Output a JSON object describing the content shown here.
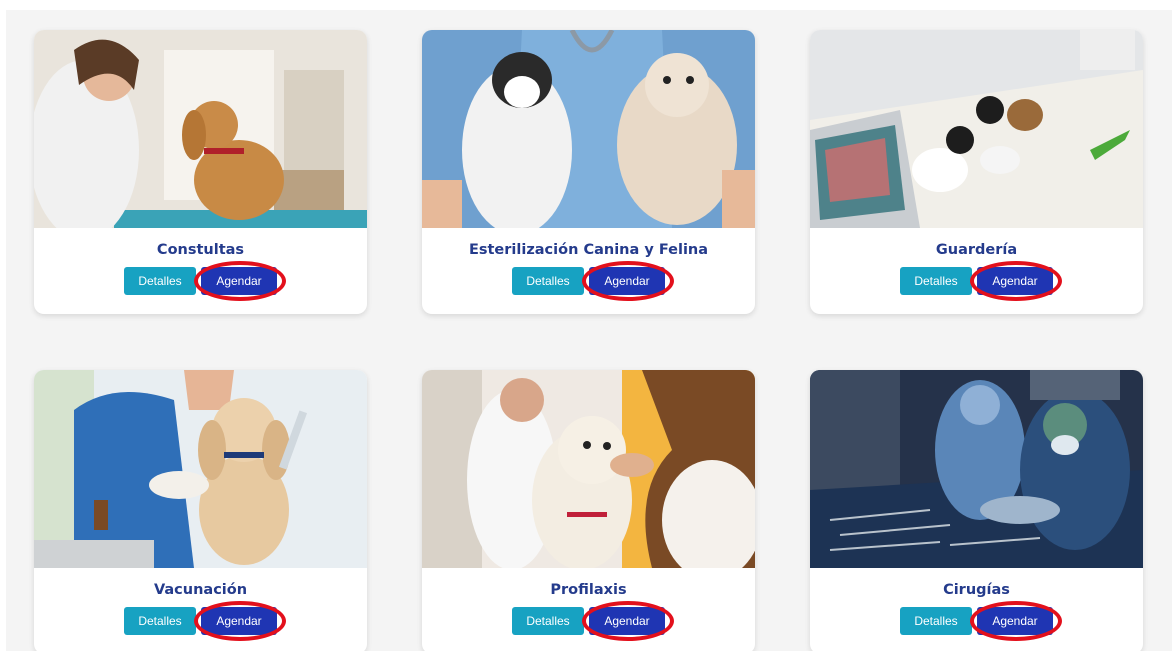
{
  "services": [
    {
      "title": "Constultas",
      "details_label": "Detalles",
      "schedule_label": "Agendar"
    },
    {
      "title": "Esterilización Canina y Felina",
      "details_label": "Detalles",
      "schedule_label": "Agendar"
    },
    {
      "title": "Guardería",
      "details_label": "Detalles",
      "schedule_label": "Agendar"
    },
    {
      "title": "Vacunación",
      "details_label": "Detalles",
      "schedule_label": "Agendar"
    },
    {
      "title": "Profilaxis",
      "details_label": "Detalles",
      "schedule_label": "Agendar"
    },
    {
      "title": "Cirugías",
      "details_label": "Detalles",
      "schedule_label": "Agendar"
    }
  ],
  "colors": {
    "title": "#243b8c",
    "details_button": "#17a2c2",
    "schedule_button": "#1f35b3",
    "highlight_ring": "#e3101c",
    "panel_background": "#f4f4f4"
  }
}
